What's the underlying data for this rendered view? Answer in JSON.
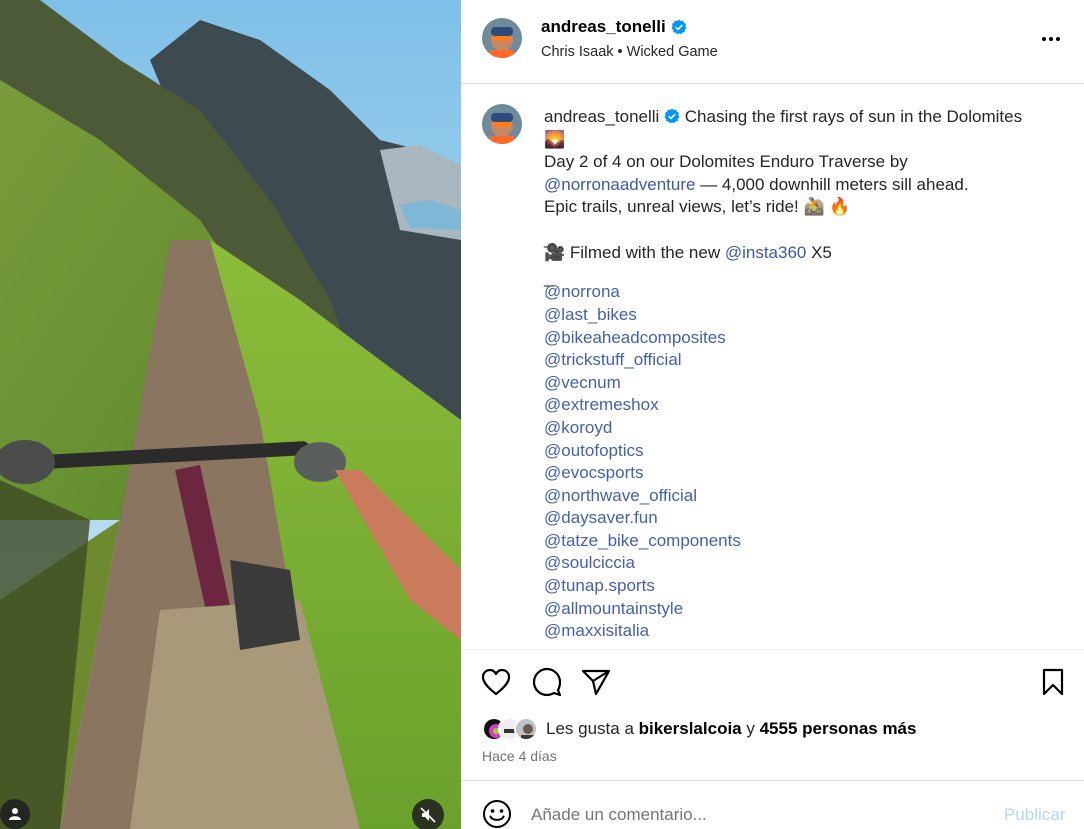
{
  "post": {
    "username": "andreas_tonelli",
    "song": "Chris Isaak • Wicked Game",
    "more_icon": "more-horizontal-icon"
  },
  "caption": {
    "username": "andreas_tonelli",
    "line1": "Chasing the first rays of sun in the Dolomites",
    "line1_emoji": "🌄",
    "line2": "Day 2 of 4 on our Dolomites Enduro Traverse by",
    "line3_mention": "@norronaadventure",
    "line3_rest": " — 4,000 downhill meters sill ahead.",
    "line4": "Epic trails, unreal views, let’s ride! 🚵 🔥",
    "dash": "_",
    "filmed_prefix": "🎥  Filmed with the new ",
    "filmed_mention": "@insta360",
    "filmed_suffix": " X5",
    "mentions": [
      "@norrona",
      "@last_bikes",
      "@bikeaheadcomposites",
      "@trickstuff_official",
      "@vecnum",
      "@extremeshox",
      "@koroyd",
      "@outofoptics",
      "@evocsports",
      "@northwave_official",
      "@daysaver.fun",
      "@tatze_bike_components",
      "@soulciccia",
      "@tunap.sports",
      "@allmountainstyle",
      "@maxxisitalia"
    ]
  },
  "likes": {
    "prefix": "Les gusta a ",
    "user": "bikerslalcoia",
    "middle": " y ",
    "count": "4555 personas más"
  },
  "time": "Hace 4 días",
  "comment": {
    "placeholder": "Añade un comentario...",
    "publish": "Publicar"
  },
  "colors": {
    "mention": "#4560b0",
    "verified": "#0095f6",
    "publish_disabled": "#b3d6fb"
  }
}
